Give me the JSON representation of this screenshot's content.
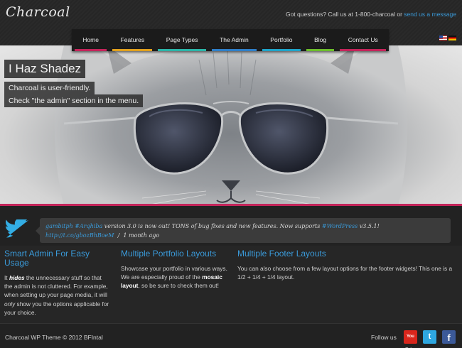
{
  "header": {
    "logo": "Charcoal",
    "contact_text": "Got questions? Call us at 1-800-charcoal or",
    "contact_link": "send us a message"
  },
  "nav": {
    "items": [
      {
        "label": "Home",
        "color": "#c3245a"
      },
      {
        "label": "Features",
        "color": "#e0a01e"
      },
      {
        "label": "Page Types",
        "color": "#2bb5a8"
      },
      {
        "label": "The Admin",
        "color": "#2f7fc8"
      },
      {
        "label": "Portfolio",
        "color": "#1fa4c9"
      },
      {
        "label": "Blog",
        "color": "#6cbd2c"
      },
      {
        "label": "Contact Us",
        "color": "#c3245a"
      }
    ]
  },
  "flags": [
    "us-flag-icon",
    "de-flag-icon"
  ],
  "hero": {
    "title": "I Haz Shadez",
    "line1": "Charcoal is user-friendly.",
    "line2": "Check \"the admin\" section in the menu."
  },
  "tweet": {
    "user": "gambitph",
    "hashtag1": "#Arqhiba",
    "text1": "version 3.0 is now out! TONS of bug fixes and new features. Now supports",
    "hashtag2": "#WordPress",
    "text2": "v3.5.1!",
    "link": "http://t.co/gbozBhBoeM",
    "sep": "/",
    "time": "1 month ago"
  },
  "columns": [
    {
      "title": "Smart Admin For Easy Usage",
      "p_start": "It",
      "p_bold": "hides",
      "p_rest1": "the unnecessary stuff so that the admin is not cluttered. For example, when setting up your page media, it will",
      "p_em": "only",
      "p_rest2": "show you the options applicable for your choice."
    },
    {
      "title": "Multiple Portfolio Layouts",
      "p_start": "Showcase your portfolio in various ways. We are especially proud of the",
      "p_bold": "mosaic layout",
      "p_rest": ", so be sure to check them out!"
    },
    {
      "title": "Multiple Footer Layouts",
      "p": "You can also choose from a few layout options for the footer widgets! This one is a 1/2 + 1/4 + 1/4 layout."
    }
  ],
  "footer": {
    "copyright": "Charcoal WP Theme © 2012 BFIntal",
    "follow": "Follow us",
    "youtube": "You Tube",
    "twitter": "t",
    "facebook": "f"
  }
}
